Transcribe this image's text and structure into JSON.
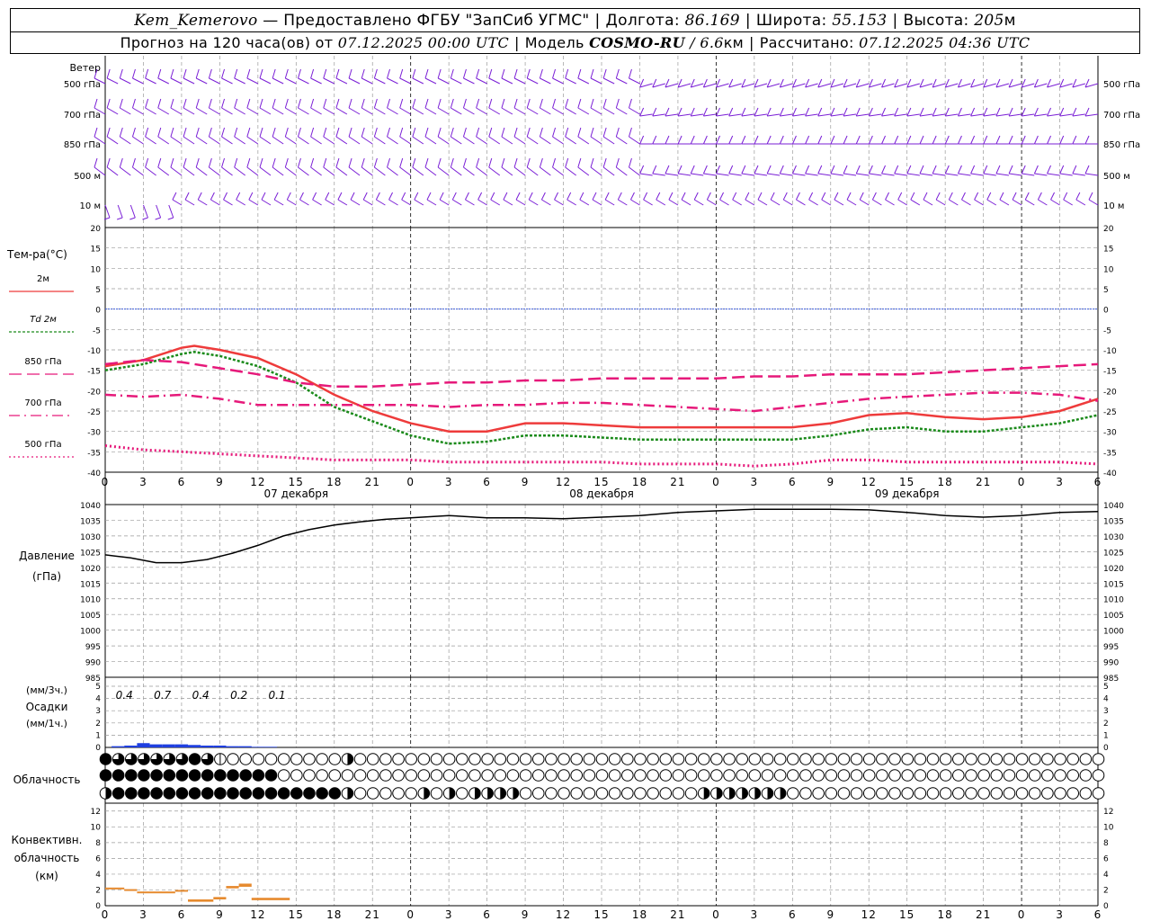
{
  "header": {
    "station": "Kem_Kemerovo",
    "provider": "— Предоставлено ФГБУ \"ЗапСиб УГМС\"",
    "lon_label": "Долгота:",
    "lon": "86.169",
    "lat_label": "Широта:",
    "lat": "55.153",
    "alt_label": "Высота:",
    "alt": "205",
    "alt_unit": "м",
    "forecast_label": "Прогноз на 120 часа(ов) от",
    "forecast_start": "07.12.2025 00:00 UTC",
    "model_label": "Модель",
    "model": "COSMO-RU",
    "model_res": "/ 6.6",
    "model_res_unit": "км",
    "calc_label": "Рассчитано:",
    "calc_time": "07.12.2025 04:36 UTC"
  },
  "time_axis": {
    "hour_ticks": [
      "0",
      "3",
      "6",
      "9",
      "12",
      "15",
      "18",
      "21",
      "0",
      "3",
      "6",
      "9",
      "12",
      "15",
      "18",
      "21",
      "0",
      "3",
      "6",
      "9",
      "12",
      "15",
      "18",
      "21",
      "0",
      "3",
      "6"
    ],
    "day_labels": [
      "07 декабря",
      "08 декабря",
      "09 декабря"
    ]
  },
  "wind": {
    "title": "Ветер",
    "levels": [
      "500 гПа",
      "700 гПа",
      "850 гПа",
      "500 м",
      "10  м"
    ]
  },
  "chart_data": [
    {
      "type": "line",
      "panel": "temperature",
      "title": "Тем-ра(°C)",
      "x_unit": "hours from forecast start",
      "ylim": [
        -40,
        20
      ],
      "yticks": [
        "20",
        "15",
        "10",
        "5",
        "0",
        "-5",
        "-10",
        "-15",
        "-20",
        "-25",
        "-30",
        "-35",
        "-40"
      ],
      "series": [
        {
          "name": "2м",
          "style": "solid",
          "color": "#ee3b3b",
          "x": [
            0,
            3,
            6,
            7,
            9,
            12,
            15,
            18,
            21,
            24,
            27,
            30,
            33,
            36,
            39,
            42,
            45,
            48,
            51,
            54,
            57,
            60,
            63,
            66,
            69,
            72,
            75,
            78
          ],
          "values": [
            -14,
            -12.5,
            -9.5,
            -9,
            -10,
            -12,
            -16,
            -21,
            -25,
            -28,
            -30,
            -30,
            -28,
            -28,
            -28.5,
            -29,
            -29,
            -29,
            -29,
            -29,
            -28,
            -26,
            -25.5,
            -26.5,
            -27,
            -26.5,
            -25,
            -22
          ]
        },
        {
          "name": "Td  2м",
          "style": "dotted",
          "color": "#1a8a1a",
          "x": [
            0,
            3,
            6,
            7,
            9,
            12,
            15,
            18,
            21,
            24,
            27,
            30,
            33,
            36,
            39,
            42,
            45,
            48,
            51,
            54,
            57,
            60,
            63,
            66,
            69,
            72,
            75,
            78
          ],
          "values": [
            -15,
            -13.5,
            -11,
            -10.5,
            -11.5,
            -14,
            -18,
            -24,
            -27.5,
            -31,
            -33,
            -32.5,
            -31,
            -31,
            -31.5,
            -32,
            -32,
            -32,
            -32,
            -32,
            -31,
            -29.5,
            -29,
            -30,
            -30,
            -29,
            -28,
            -26
          ]
        },
        {
          "name": "850 гПа",
          "style": "dashed",
          "color": "#e6197a",
          "x": [
            0,
            3,
            6,
            9,
            12,
            15,
            18,
            21,
            24,
            27,
            30,
            33,
            36,
            39,
            42,
            45,
            48,
            51,
            54,
            57,
            60,
            63,
            66,
            69,
            72,
            75,
            78
          ],
          "values": [
            -13.5,
            -12.5,
            -13,
            -14.5,
            -16,
            -18,
            -19,
            -19,
            -18.5,
            -18,
            -18,
            -17.5,
            -17.5,
            -17,
            -17,
            -17,
            -17,
            -16.5,
            -16.5,
            -16,
            -16,
            -16,
            -15.5,
            -15,
            -14.5,
            -14,
            -13.5
          ]
        },
        {
          "name": "700 гПа",
          "style": "dashdot",
          "color": "#e6197a",
          "x": [
            0,
            3,
            6,
            9,
            12,
            15,
            18,
            21,
            24,
            27,
            30,
            33,
            36,
            39,
            42,
            45,
            48,
            51,
            54,
            57,
            60,
            63,
            66,
            69,
            72,
            75,
            78
          ],
          "values": [
            -21,
            -21.5,
            -21,
            -22,
            -23.5,
            -23.5,
            -23.5,
            -23.5,
            -23.5,
            -24,
            -23.5,
            -23.5,
            -23,
            -23,
            -23.5,
            -24,
            -24.5,
            -25,
            -24,
            -23,
            -22,
            -21.5,
            -21,
            -20.5,
            -20.5,
            -21,
            -22.5
          ]
        },
        {
          "name": "500 гПа",
          "style": "fine-dotted",
          "color": "#e6197a",
          "x": [
            0,
            3,
            6,
            9,
            12,
            15,
            18,
            21,
            24,
            27,
            30,
            33,
            36,
            39,
            42,
            45,
            48,
            51,
            54,
            57,
            60,
            63,
            66,
            69,
            72,
            75,
            78
          ],
          "values": [
            -33.5,
            -34.5,
            -35,
            -35.5,
            -36,
            -36.5,
            -37,
            -37,
            -37,
            -37.5,
            -37.5,
            -37.5,
            -37.5,
            -37.5,
            -38,
            -38,
            -38,
            -38.5,
            -38,
            -37,
            -37,
            -37.5,
            -37.5,
            -37.5,
            -37.5,
            -37.5,
            -38
          ]
        }
      ]
    },
    {
      "type": "line",
      "panel": "pressure",
      "title": "Давление",
      "ylabel": "(гПа)",
      "ylim": [
        985,
        1040
      ],
      "yticks": [
        "1040",
        "1035",
        "1030",
        "1025",
        "1020",
        "1015",
        "1010",
        "1005",
        "1000",
        "995",
        "990",
        "985"
      ],
      "series": [
        {
          "color": "#000000",
          "x": [
            0,
            2,
            4,
            6,
            8,
            10,
            12,
            14,
            16,
            18,
            20,
            22,
            24,
            27,
            30,
            33,
            36,
            39,
            42,
            45,
            48,
            51,
            54,
            57,
            60,
            63,
            66,
            69,
            72,
            75,
            78
          ],
          "values": [
            1024,
            1023,
            1021.5,
            1021.5,
            1022.5,
            1024.5,
            1027,
            1030,
            1032,
            1033.5,
            1034.5,
            1035.3,
            1035.8,
            1036.5,
            1035.8,
            1035.8,
            1035.5,
            1036,
            1036.5,
            1037.5,
            1038,
            1038.5,
            1038.5,
            1038.5,
            1038.3,
            1037.5,
            1036.5,
            1036,
            1036.5,
            1037.5,
            1037.8
          ]
        }
      ]
    },
    {
      "type": "bar",
      "panel": "precipitation",
      "title": "Осадки",
      "ylabel_top": "(мм/3ч.)",
      "ylabel_bottom": "(мм/1ч.)",
      "ylim": [
        0,
        5
      ],
      "yticks": [
        "5",
        "4",
        "3",
        "2",
        "1",
        "0"
      ],
      "totals_3h": [
        "0.4",
        "0.7",
        "0.4",
        "0.2",
        "0.1"
      ],
      "hourly_x": [
        1,
        2,
        3,
        4,
        5,
        6,
        7,
        8,
        9,
        10,
        11,
        12,
        13
      ],
      "hourly_values": [
        0.1,
        0.15,
        0.35,
        0.25,
        0.25,
        0.25,
        0.2,
        0.15,
        0.15,
        0.1,
        0.1,
        0.05,
        0.05
      ],
      "color": "#1f3fe0"
    },
    {
      "type": "table",
      "panel": "cloudiness",
      "title": "Облачность",
      "note": "cloud cover in eighths per 1-hour step (rows: upper, middle, lower)",
      "rows": [
        [
          8,
          6,
          6,
          6,
          6,
          6,
          7,
          8,
          6,
          1,
          0,
          0,
          0,
          0,
          0,
          0,
          0,
          0,
          0,
          4,
          0,
          0,
          0,
          0,
          0,
          0,
          0,
          0,
          0,
          0,
          0,
          0,
          0,
          0,
          0,
          0,
          0,
          0,
          0,
          0,
          0,
          0,
          0,
          0,
          0,
          0,
          0,
          0,
          0,
          0,
          0,
          0,
          0,
          0,
          0,
          0,
          0,
          0,
          0,
          0,
          0,
          0,
          0,
          0,
          0,
          0,
          0,
          0,
          0,
          0,
          0,
          0,
          0,
          0,
          0,
          0,
          0,
          0,
          0
        ],
        [
          8,
          8,
          8,
          8,
          8,
          8,
          8,
          8,
          8,
          8,
          8,
          8,
          8,
          8,
          0,
          0,
          0,
          0,
          0,
          0,
          0,
          0,
          0,
          0,
          0,
          0,
          0,
          0,
          0,
          0,
          0,
          0,
          0,
          0,
          0,
          0,
          0,
          0,
          0,
          0,
          0,
          0,
          0,
          0,
          0,
          0,
          0,
          0,
          0,
          0,
          0,
          0,
          0,
          0,
          0,
          0,
          0,
          0,
          0,
          0,
          0,
          0,
          0,
          0,
          0,
          0,
          0,
          0,
          0,
          0,
          0,
          0,
          0,
          0,
          0,
          0,
          0,
          0,
          0
        ],
        [
          4,
          8,
          8,
          8,
          8,
          8,
          8,
          8,
          8,
          8,
          8,
          8,
          8,
          8,
          8,
          8,
          8,
          8,
          8,
          4,
          0,
          0,
          0,
          0,
          0,
          4,
          0,
          4,
          0,
          4,
          4,
          4,
          4,
          0,
          0,
          0,
          0,
          0,
          0,
          0,
          0,
          0,
          0,
          0,
          0,
          0,
          0,
          4,
          4,
          4,
          4,
          4,
          4,
          4,
          0,
          0,
          0,
          0,
          0,
          0,
          0,
          0,
          0,
          0,
          0,
          0,
          0,
          0,
          0,
          0,
          0,
          0,
          0,
          0,
          0,
          0,
          0,
          0,
          0
        ]
      ]
    },
    {
      "type": "bar",
      "panel": "convective",
      "title": "Конвективн.",
      "title2": "облачность",
      "ylabel": "(км)",
      "ylim": [
        0,
        13
      ],
      "yticks": [
        "12",
        "10",
        "8",
        "6",
        "4",
        "2",
        "0"
      ],
      "segments": [
        {
          "x0": 0,
          "x1": 1.5,
          "y0": 2.1,
          "y1": 2.3
        },
        {
          "x0": 1.5,
          "x1": 2.5,
          "y0": 1.9,
          "y1": 2.1
        },
        {
          "x0": 2.5,
          "x1": 5.5,
          "y0": 1.6,
          "y1": 1.8
        },
        {
          "x0": 5.5,
          "x1": 6.5,
          "y0": 1.8,
          "y1": 2.0
        },
        {
          "x0": 6.5,
          "x1": 8.5,
          "y0": 0.5,
          "y1": 0.8
        },
        {
          "x0": 8.5,
          "x1": 9.5,
          "y0": 0.8,
          "y1": 1.1
        },
        {
          "x0": 9.5,
          "x1": 10.5,
          "y0": 2.2,
          "y1": 2.5
        },
        {
          "x0": 10.5,
          "x1": 11.5,
          "y0": 2.4,
          "y1": 2.8
        },
        {
          "x0": 11.5,
          "x1": 14.5,
          "y0": 0.7,
          "y1": 1.0
        }
      ],
      "color": "#e68a2e"
    }
  ]
}
